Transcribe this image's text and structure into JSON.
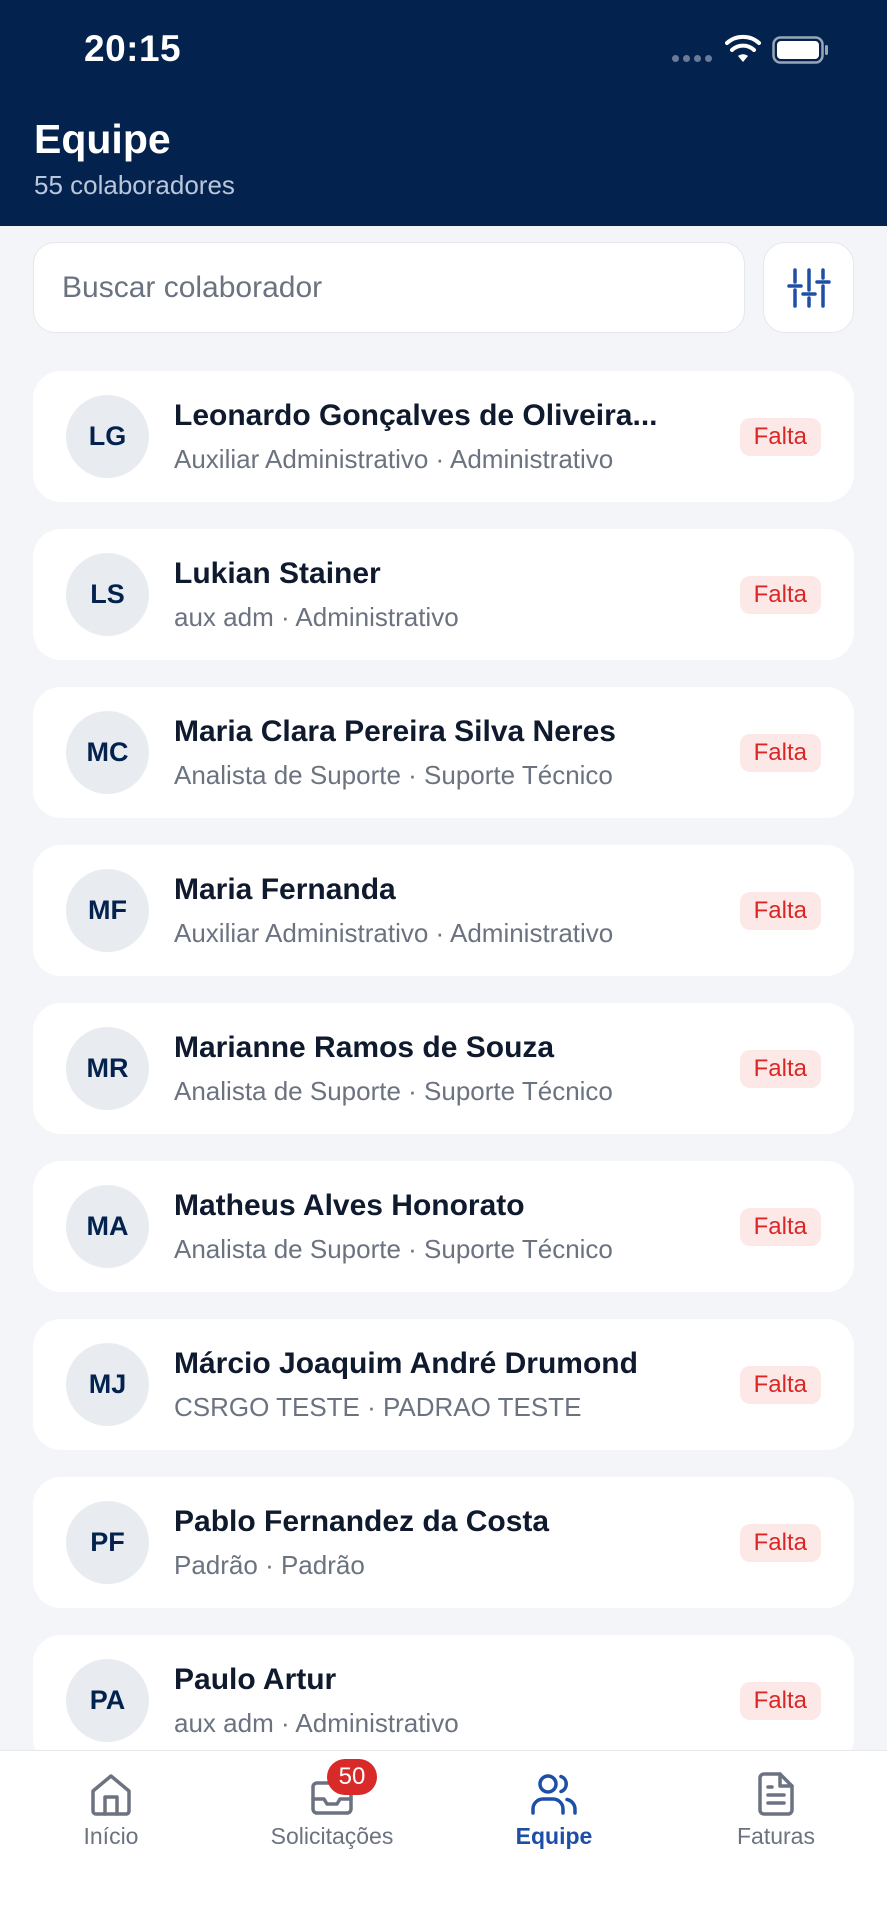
{
  "status_bar": {
    "time": "20:15"
  },
  "header": {
    "title": "Equipe",
    "subtitle": "55 colaboradores"
  },
  "search": {
    "placeholder": "Buscar colaborador"
  },
  "employees": [
    {
      "initials": "LG",
      "name": "Leonardo Gonçalves de Oliveira...",
      "role": "Auxiliar Administrativo · Administrativo",
      "status": "Falta"
    },
    {
      "initials": "LS",
      "name": "Lukian Stainer",
      "role": "aux adm · Administrativo",
      "status": "Falta"
    },
    {
      "initials": "MC",
      "name": "Maria Clara Pereira Silva Neres",
      "role": "Analista de Suporte · Suporte Técnico",
      "status": "Falta"
    },
    {
      "initials": "MF",
      "name": "Maria Fernanda",
      "role": "Auxiliar Administrativo · Administrativo",
      "status": "Falta"
    },
    {
      "initials": "MR",
      "name": "Marianne Ramos de Souza",
      "role": "Analista de Suporte · Suporte Técnico",
      "status": "Falta"
    },
    {
      "initials": "MA",
      "name": "Matheus Alves Honorato",
      "role": "Analista de Suporte · Suporte Técnico",
      "status": "Falta"
    },
    {
      "initials": "MJ",
      "name": "Márcio Joaquim André Drumond",
      "role": "CSRGO TESTE · PADRAO TESTE",
      "status": "Falta"
    },
    {
      "initials": "PF",
      "name": "Pablo Fernandez da Costa",
      "role": "Padrão · Padrão",
      "status": "Falta"
    },
    {
      "initials": "PA",
      "name": "Paulo Artur",
      "role": "aux adm · Administrativo",
      "status": "Falta"
    }
  ],
  "nav": {
    "items": [
      {
        "label": "Início",
        "icon": "home-icon"
      },
      {
        "label": "Solicitações",
        "icon": "inbox-icon",
        "badge": "50"
      },
      {
        "label": "Equipe",
        "icon": "users-icon",
        "active": true
      },
      {
        "label": "Faturas",
        "icon": "file-text-icon"
      }
    ]
  },
  "colors": {
    "header_bg": "#03224d",
    "accent": "#1e4fa6",
    "badge_bg": "#fde8e8",
    "badge_text": "#dc2626",
    "nav_badge": "#d92a2a"
  }
}
